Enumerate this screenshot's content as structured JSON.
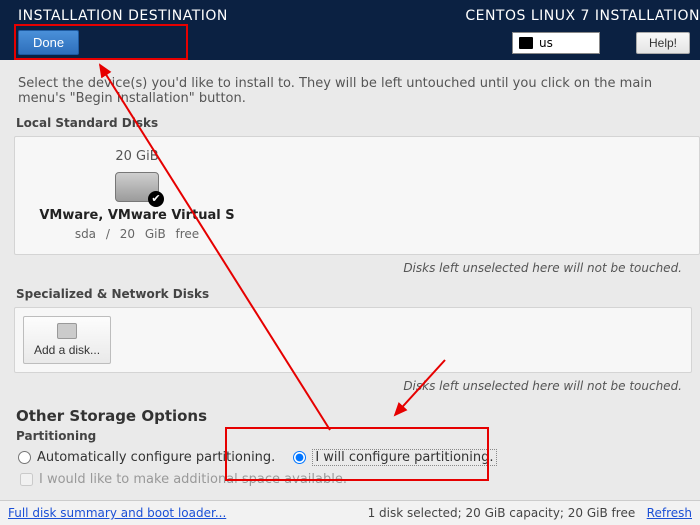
{
  "header": {
    "title": "INSTALLATION DESTINATION",
    "product": "CENTOS LINUX 7 INSTALLATION",
    "done": "Done",
    "keyboard": "us",
    "help": "Help!"
  },
  "intro": "Select the device(s) you'd like to install to.  They will be left untouched until you click on the main menu's \"Begin Installation\" button.",
  "sections": {
    "local_label": "Local Standard Disks",
    "net_label": "Specialized & Network Disks",
    "hint": "Disks left unselected here will not be touched."
  },
  "disk": {
    "size": "20 GiB",
    "name": "VMware, VMware Virtual S",
    "id": "sda",
    "sep": "/",
    "free": "20 GiB free"
  },
  "add_disk": "Add a disk...",
  "other": {
    "heading": "Other Storage Options",
    "partitioning_label": "Partitioning",
    "auto": "Automatically configure partitioning.",
    "manual": "I will configure partitioning.",
    "reclaim": "I would like to make additional space available."
  },
  "footer": {
    "summary_link": "Full disk summary and boot loader...",
    "status": "1 disk selected; 20 GiB capacity; 20 GiB free",
    "refresh": "Refresh"
  }
}
